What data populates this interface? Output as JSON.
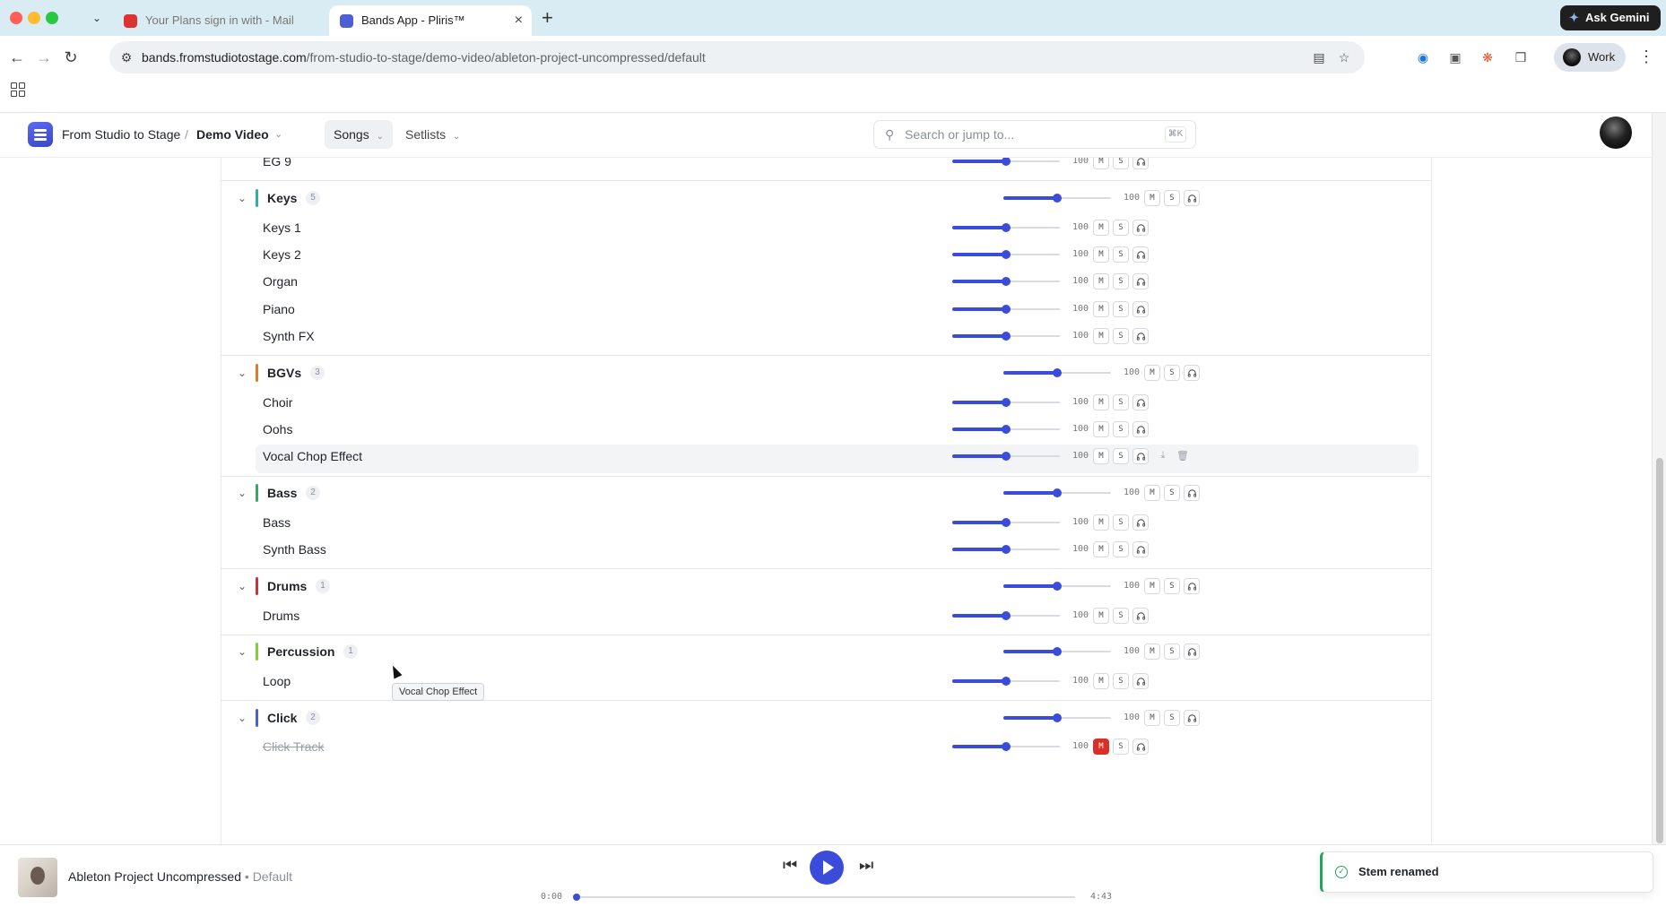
{
  "browser": {
    "tabs": [
      {
        "title": "Your Plans sign in with - Mail",
        "active": false
      },
      {
        "title": "Bands App - Pliris™",
        "active": true
      }
    ],
    "url_host": "bands.fromstudiotostage.com",
    "url_path": "/from-studio-to-stage/demo-video/ableton-project-uncompressed/default",
    "gemini_label": "Ask Gemini",
    "profile_label": "Work"
  },
  "header": {
    "workspace": "From Studio to Stage",
    "separator": "/",
    "project": "Demo Video",
    "tabs": [
      {
        "label": "Songs",
        "active": true
      },
      {
        "label": "Setlists",
        "active": false
      }
    ],
    "search_placeholder": "Search or jump to...",
    "search_shortcut": "⌘K"
  },
  "stem_groups": [
    {
      "name": "",
      "count": "",
      "color": "",
      "partial": true,
      "stems": [
        {
          "name": "EG 9",
          "volume": "100",
          "level": 50,
          "muted": false
        }
      ]
    },
    {
      "name": "Keys",
      "count": "5",
      "color": "#2bb39a",
      "group_volume": "100",
      "group_level": 50,
      "stems": [
        {
          "name": "Keys 1",
          "volume": "100",
          "level": 50,
          "muted": false
        },
        {
          "name": "Keys 2",
          "volume": "100",
          "level": 50,
          "muted": false
        },
        {
          "name": "Organ",
          "volume": "100",
          "level": 50,
          "muted": false
        },
        {
          "name": "Piano",
          "volume": "100",
          "level": 50,
          "muted": false
        },
        {
          "name": "Synth FX",
          "volume": "100",
          "level": 50,
          "muted": false
        }
      ]
    },
    {
      "name": "BGVs",
      "count": "3",
      "color": "#e07a2e",
      "group_volume": "100",
      "group_level": 50,
      "stems": [
        {
          "name": "Choir",
          "volume": "100",
          "level": 50,
          "muted": false
        },
        {
          "name": "Oohs",
          "volume": "100",
          "level": 50,
          "muted": false
        },
        {
          "name": "Vocal Chop Effect",
          "volume": "100",
          "level": 50,
          "muted": false,
          "hovered": true
        }
      ]
    },
    {
      "name": "Bass",
      "count": "2",
      "color": "#3aa864",
      "group_volume": "100",
      "group_level": 50,
      "stems": [
        {
          "name": "Bass",
          "volume": "100",
          "level": 50,
          "muted": false
        },
        {
          "name": "Synth Bass",
          "volume": "100",
          "level": 50,
          "muted": false
        }
      ]
    },
    {
      "name": "Drums",
      "count": "1",
      "color": "#c8343a",
      "group_volume": "100",
      "group_level": 50,
      "stems": [
        {
          "name": "Drums",
          "volume": "100",
          "level": 50,
          "muted": false
        }
      ]
    },
    {
      "name": "Percussion",
      "count": "1",
      "color": "#7fcf3c",
      "group_volume": "100",
      "group_level": 50,
      "stems": [
        {
          "name": "Loop",
          "volume": "100",
          "level": 50,
          "muted": false
        }
      ]
    },
    {
      "name": "Click",
      "count": "2",
      "color": "#4d5fd6",
      "group_volume": "100",
      "group_level": 50,
      "stems": [
        {
          "name": "Click Track",
          "volume": "100",
          "level": 50,
          "muted": true
        }
      ]
    }
  ],
  "controls": {
    "mute": "M",
    "solo": "S"
  },
  "tooltip": "Vocal Chop Effect",
  "player": {
    "title": "Ableton Project Uncompressed",
    "dot": "•",
    "variant": "Default",
    "elapsed": "0:00",
    "duration": "4:43",
    "progress": 0
  },
  "toast": {
    "message": "Stem renamed"
  },
  "colors": {
    "accent": "#3b4cdb",
    "mute_active": "#d93025",
    "success": "#22a35a"
  }
}
